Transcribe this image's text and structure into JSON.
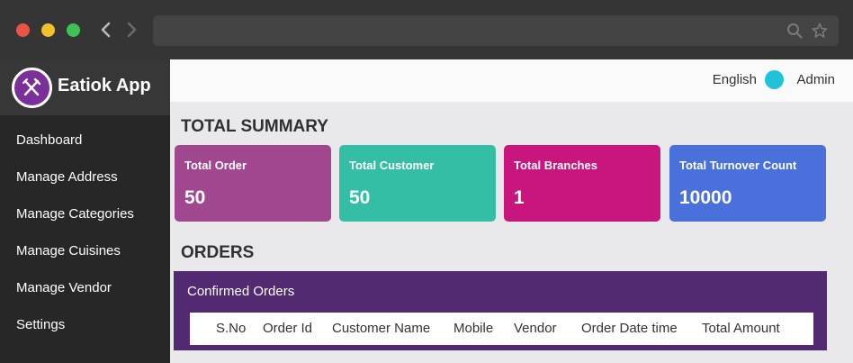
{
  "app": {
    "name": "Eatiok App"
  },
  "sidebar": {
    "items": [
      {
        "label": "Dashboard"
      },
      {
        "label": "Manage Address"
      },
      {
        "label": "Manage Categories"
      },
      {
        "label": "Manage Cuisines"
      },
      {
        "label": "Manage Vendor"
      },
      {
        "label": "Settings"
      }
    ]
  },
  "topbar": {
    "language": "English",
    "user": "Admin"
  },
  "summary": {
    "title": "TOTAL SUMMARY",
    "cards": [
      {
        "label": "Total Order",
        "value": "50",
        "color": "#a0478f"
      },
      {
        "label": "Total Customer",
        "value": "50",
        "color": "#35bea6"
      },
      {
        "label": "Total Branches",
        "value": "1",
        "color": "#c9157e"
      },
      {
        "label": "Total Turnover Count",
        "value": "10000",
        "color": "#4a70db"
      }
    ]
  },
  "orders": {
    "title": "ORDERS",
    "panel_title": "Confirmed Orders",
    "columns": [
      "S.No",
      "Order Id",
      "Customer Name",
      "Mobile",
      "Vendor",
      "Order Date time",
      "Total Amount"
    ]
  },
  "icons": {
    "logo": "fork-knife-icon",
    "search": "search-icon",
    "bookmark": "star-icon",
    "back": "chevron-left-icon",
    "forward": "chevron-right-icon"
  },
  "colors": {
    "accent": "#522a72",
    "avatar": "#1fc2d6",
    "sidebar": "#272727"
  }
}
